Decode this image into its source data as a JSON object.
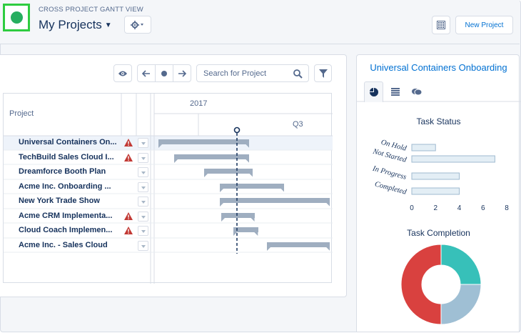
{
  "header": {
    "eyebrow": "CROSS PROJECT GANTT VIEW",
    "title": "My Projects",
    "new_project_label": "New Project",
    "settings_icon": "gear-icon",
    "calendar_icon": "calendar-grid-icon"
  },
  "toolbar": {
    "search_placeholder": "Search for Project",
    "eye_icon": "eye-icon",
    "prev_icon": "arrow-left-icon",
    "today_icon": "dot-icon",
    "next_icon": "arrow-right-icon",
    "filter_icon": "filter-icon"
  },
  "gantt": {
    "column_header": "Project",
    "year_label": "2017",
    "quarter_label": "Q3",
    "rows": [
      {
        "name": "Universal Containers On...",
        "warning": true,
        "start": 0.02,
        "end": 0.54,
        "selected": true
      },
      {
        "name": "TechBuild Sales Cloud I...",
        "warning": true,
        "start": 0.11,
        "end": 0.54
      },
      {
        "name": "Dreamforce Booth Plan",
        "warning": false,
        "start": 0.28,
        "end": 0.56
      },
      {
        "name": "Acme Inc. Onboarding ...",
        "warning": false,
        "start": 0.37,
        "end": 0.74
      },
      {
        "name": "New York Trade Show",
        "warning": false,
        "start": 0.37,
        "end": 1.0
      },
      {
        "name": "Acme CRM Implementa...",
        "warning": true,
        "start": 0.38,
        "end": 0.57
      },
      {
        "name": "Cloud Coach Implemen...",
        "warning": true,
        "start": 0.45,
        "end": 0.59
      },
      {
        "name": "Acme Inc. - Sales Cloud",
        "warning": false,
        "start": 0.64,
        "end": 1.0
      }
    ],
    "today_position": 0.47
  },
  "right_panel": {
    "title": "Universal Containers Onboarding",
    "tabs": [
      "pie-chart-icon",
      "list-icon",
      "chat-icon"
    ],
    "task_status_title": "Task Status",
    "task_completion_title": "Task Completion"
  },
  "chart_data": [
    {
      "type": "bar",
      "title": "Task Status",
      "orientation": "horizontal",
      "categories": [
        "On Hold",
        "Not Started",
        "In Progress",
        "Completed"
      ],
      "values": [
        2,
        7,
        4,
        4
      ],
      "xlim": [
        0,
        8
      ],
      "xticks": [
        "0",
        "2",
        "4",
        "6",
        "8"
      ],
      "colors": {
        "fill": "#e3eef5",
        "stroke": "#9fbad0"
      }
    },
    {
      "type": "pie",
      "title": "Task Completion",
      "donut": true,
      "values": [
        0.25,
        0.25,
        0.5
      ],
      "colors": [
        "#37c0b9",
        "#9fbfd4",
        "#d9413f"
      ]
    }
  ],
  "colors": {
    "brand_blue": "#0070d2",
    "warning_red": "#c23934",
    "bar_gray": "#9faec0"
  }
}
